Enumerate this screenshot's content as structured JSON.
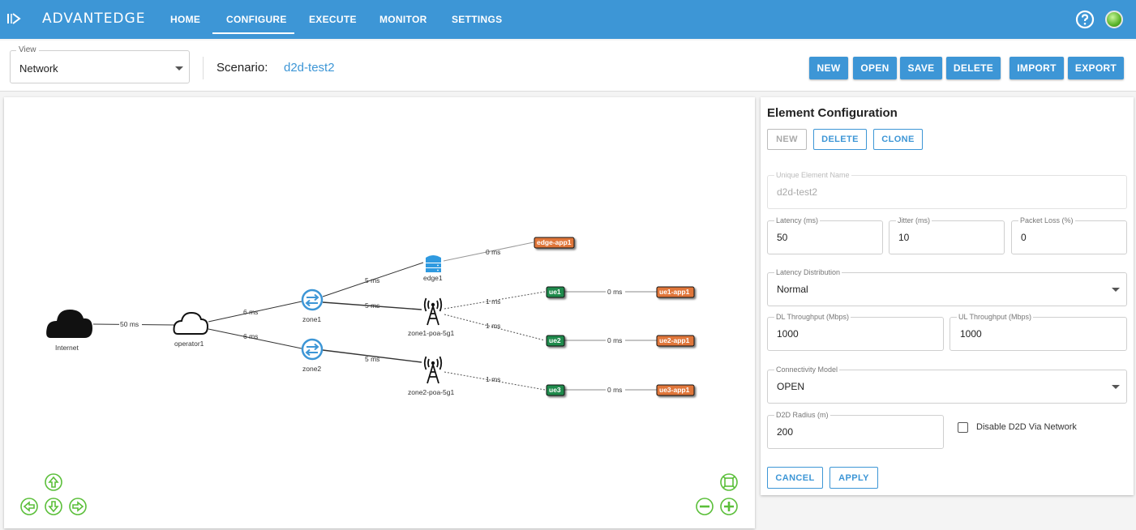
{
  "app": {
    "brand": "ADVANTEDGE",
    "nav": [
      "HOME",
      "CONFIGURE",
      "EXECUTE",
      "MONITOR",
      "SETTINGS"
    ],
    "active_tab": "CONFIGURE",
    "icons": {
      "logo": "logo-arrow-icon",
      "help": "help-icon",
      "status": "status-indicator-icon"
    },
    "accent_color": "#3d96d6"
  },
  "scenario_bar": {
    "view_label": "View",
    "view_value": "Network",
    "scenario_label": "Scenario:",
    "scenario_name": "d2d-test2",
    "buttons": [
      "NEW",
      "OPEN",
      "SAVE",
      "DELETE",
      "IMPORT",
      "EXPORT"
    ]
  },
  "graph": {
    "nodes": {
      "internet": "Internet",
      "operator1": "operator1",
      "zone1": "zone1",
      "zone2": "zone2",
      "edge1": "edge1",
      "zone1_poa": "zone1-poa-5g1",
      "zone2_poa": "zone2-poa-5g1",
      "ue1": "ue1",
      "ue2": "ue2",
      "ue3": "ue3",
      "edge_app1": "edge-app1",
      "ue1_app1": "ue1-app1",
      "ue2_app1": "ue2-app1",
      "ue3_app1": "ue3-app1"
    },
    "edges": {
      "internet_operator": "50 ms",
      "operator_zone1": "6 ms",
      "operator_zone2": "6 ms",
      "zone1_edge1": "5 ms",
      "zone1_poa": "5 ms",
      "zone2_poa": "5 ms",
      "edge1_app": "0 ms",
      "poa1_ue1": "1 ms",
      "poa1_ue2": "1 ms",
      "poa2_ue3": "1 ms",
      "ue1_app": "0 ms",
      "ue2_app": "0 ms",
      "ue3_app": "0 ms"
    },
    "colors": {
      "app": "#e0763a",
      "ue": "#1f8a4c",
      "router": "#3d96d6",
      "controls": "#5bbf3a"
    },
    "controls": [
      "pan-up-icon",
      "pan-left-icon",
      "pan-down-icon",
      "pan-right-icon",
      "fit-view-icon",
      "zoom-out-icon",
      "zoom-in-icon"
    ]
  },
  "config": {
    "title": "Element Configuration",
    "actions": [
      "NEW",
      "DELETE",
      "CLONE"
    ],
    "name_label": "Unique Element Name",
    "name_value": "d2d-test2",
    "latency_label": "Latency (ms)",
    "latency_value": "50",
    "jitter_label": "Jitter (ms)",
    "jitter_value": "10",
    "loss_label": "Packet Loss (%)",
    "loss_value": "0",
    "distribution_label": "Latency Distribution",
    "distribution_value": "Normal",
    "dl_label": "DL Throughput (Mbps)",
    "dl_value": "1000",
    "ul_label": "UL Throughput (Mbps)",
    "ul_value": "1000",
    "connectivity_label": "Connectivity Model",
    "connectivity_value": "OPEN",
    "d2d_label": "D2D Radius (m)",
    "d2d_value": "200",
    "checkbox_label": "Disable D2D Via Network",
    "checkbox_checked": false,
    "cancel": "CANCEL",
    "apply": "APPLY"
  }
}
